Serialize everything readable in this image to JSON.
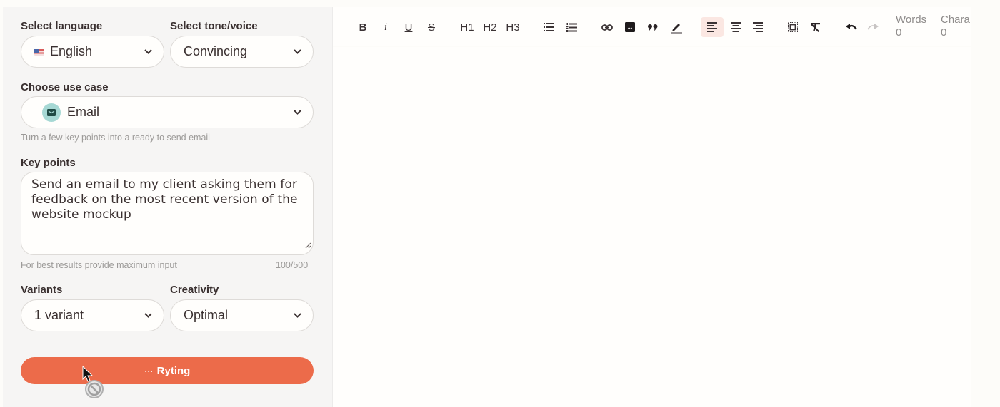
{
  "sidebar": {
    "language": {
      "label": "Select language",
      "value": "English",
      "flag": "us-flag-icon"
    },
    "tone": {
      "label": "Select tone/voice",
      "value": "Convincing"
    },
    "use_case": {
      "label": "Choose use case",
      "value": "Email",
      "icon": "mail-icon",
      "hint": "Turn a few key points into a ready to send email"
    },
    "key_points": {
      "label": "Key points",
      "value": "Send an email to my client asking them for feedback on the most recent version of the website mockup",
      "hint": "For best results provide maximum input",
      "count": "100/500"
    },
    "variants": {
      "label": "Variants",
      "value": "1 variant"
    },
    "creativity": {
      "label": "Creativity",
      "value": "Optimal"
    },
    "generate_button": {
      "dots": "···",
      "label": "Ryting",
      "color": "#ec6b4a"
    }
  },
  "toolbar": {
    "bold": "B",
    "italic": "i",
    "underline": "U",
    "strike": "S",
    "h1": "H1",
    "h2": "H2",
    "h3": "H3",
    "active_align": "align-left",
    "words_label": "Words",
    "words_count": "0",
    "chars_label": "Chara",
    "chars_count": "0"
  }
}
